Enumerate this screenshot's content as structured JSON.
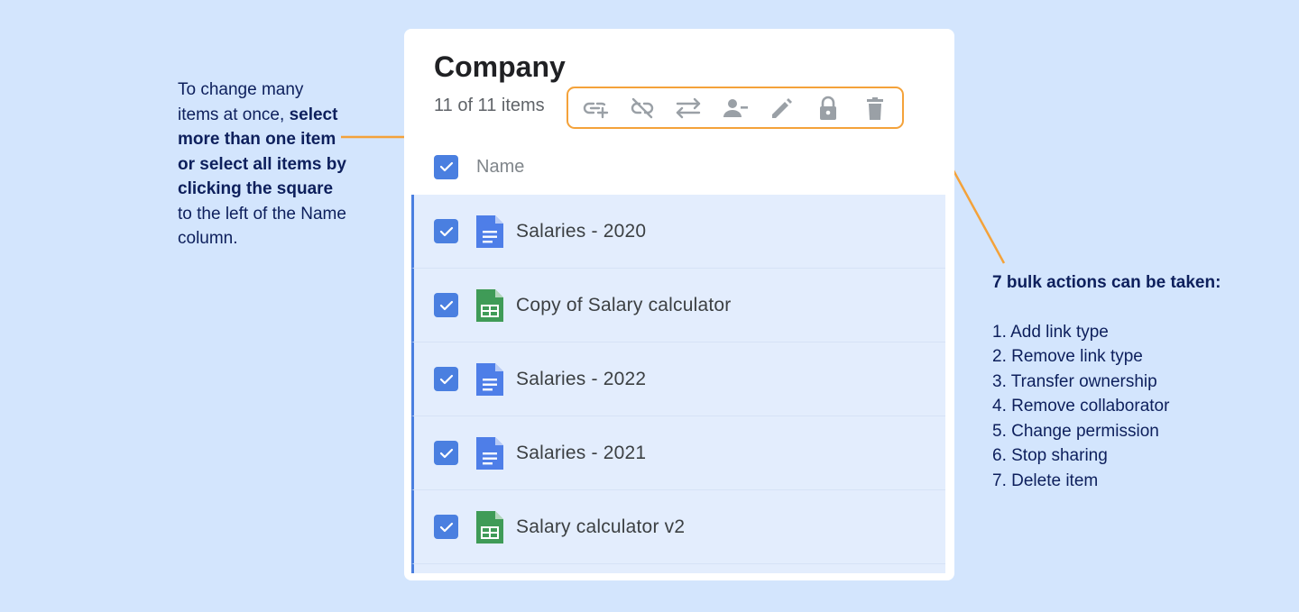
{
  "left_note": {
    "line1": "To change many items at once, ",
    "bold": "select more than one item or select all items by clicking the square",
    "line2": " to the left of the Name column."
  },
  "right_note": {
    "heading": "7 bulk actions can be taken:",
    "items": [
      "1. Add link type",
      "2. Remove link type",
      "3. Transfer ownership",
      "4. Remove collaborator",
      "5. Change permission",
      "6. Stop sharing",
      "7. Delete item"
    ]
  },
  "card": {
    "title": "Company",
    "count": "11 of 11 items",
    "column_header": "Name",
    "toolbar_icons": [
      "add-link-icon",
      "remove-link-icon",
      "transfer-icon",
      "remove-person-icon",
      "pencil-icon",
      "lock-icon",
      "trash-icon"
    ],
    "rows": [
      {
        "name": "Salaries - 2020",
        "type": "doc"
      },
      {
        "name": "Copy of Salary calculator",
        "type": "sheet"
      },
      {
        "name": "Salaries - 2022",
        "type": "doc"
      },
      {
        "name": "Salaries - 2021",
        "type": "doc"
      },
      {
        "name": "Salary calculator v2",
        "type": "sheet"
      },
      {
        "name": "",
        "type": "doc"
      }
    ]
  },
  "colors": {
    "background": "#d3e5fd",
    "accent": "#4a7fe0",
    "highlight": "#f4a23a",
    "annotation_text": "#0d1f5c",
    "doc_icon": "#4e7ee8",
    "sheet_icon": "#3f9b57"
  }
}
